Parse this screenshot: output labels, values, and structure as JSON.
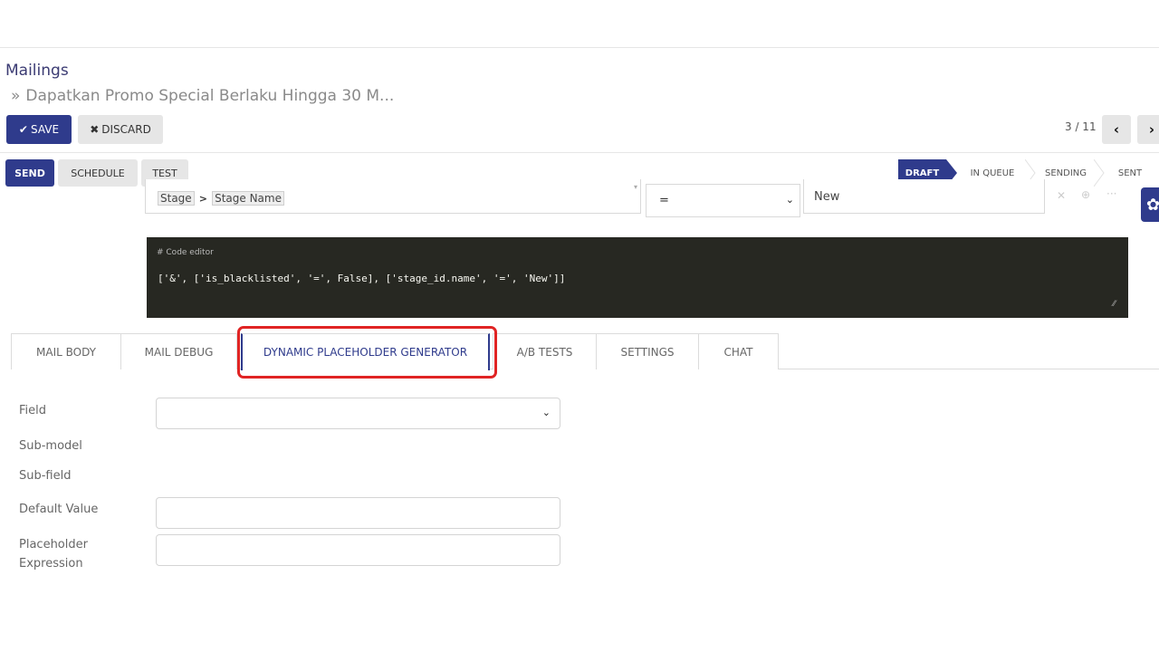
{
  "breadcrumb": {
    "root": "Mailings",
    "separator": "»",
    "current": "Dapatkan Promo Special Berlaku Hingga 30 M..."
  },
  "control_panel": {
    "save_label": "SAVE",
    "discard_label": "DISCARD",
    "pager": "3 / 11",
    "prev_icon": "‹",
    "next_icon": "›"
  },
  "header_buttons": {
    "send": "SEND",
    "schedule": "SCHEDULE",
    "test": "TEST"
  },
  "stages": {
    "items": [
      "DRAFT",
      "IN QUEUE",
      "SENDING",
      "SENT"
    ],
    "active": "DRAFT"
  },
  "domain_row": {
    "path_part1": "Stage",
    "path_arrow": ">",
    "path_part2": "Stage Name",
    "operator": "=",
    "value": "New"
  },
  "code_editor": {
    "label": "# Code editor",
    "code": "['&', ['is_blacklisted', '=', False], ['stage_id.name', '=', 'New']]"
  },
  "tabs": {
    "items": [
      "MAIL BODY",
      "MAIL DEBUG",
      "DYNAMIC PLACEHOLDER GENERATOR",
      "A/B TESTS",
      "SETTINGS",
      "CHAT"
    ],
    "active": "DYNAMIC PLACEHOLDER GENERATOR"
  },
  "placeholder_form": {
    "field_label": "Field",
    "field_value": "",
    "sub_model_label": "Sub-model",
    "sub_field_label": "Sub-field",
    "default_value_label": "Default Value",
    "default_value": "",
    "placeholder_expression_label": "Placeholder Expression",
    "placeholder_expression": ""
  },
  "colors": {
    "primary": "#2f3b8c",
    "highlight": "#e02424",
    "code_bg": "#272822"
  }
}
